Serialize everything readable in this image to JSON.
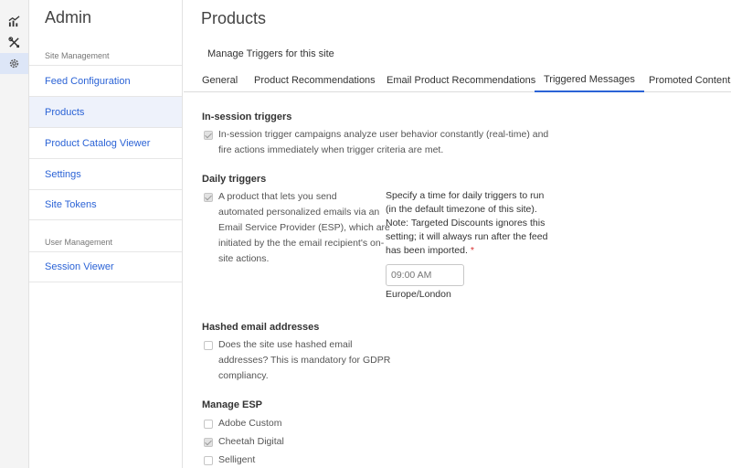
{
  "rail": {
    "icons": [
      "chart-icon",
      "tools-icon",
      "gear-icon"
    ]
  },
  "sidebar": {
    "title": "Admin",
    "section_site": "Site Management",
    "items": [
      {
        "label": "Feed Configuration"
      },
      {
        "label": "Products"
      },
      {
        "label": "Product Catalog Viewer"
      },
      {
        "label": "Settings"
      },
      {
        "label": "Site Tokens"
      }
    ],
    "section_user": "User Management",
    "user_items": [
      {
        "label": "Session Viewer"
      }
    ]
  },
  "main": {
    "title": "Products",
    "manage_title": "Manage Triggers for this site",
    "tabs": [
      {
        "label": "General"
      },
      {
        "label": "Product Recommendations"
      },
      {
        "label": "Email Product Recommendations"
      },
      {
        "label": "Triggered Messages"
      },
      {
        "label": "Promoted Content"
      }
    ],
    "active_tab": "Triggered Messages",
    "in_session": {
      "heading": "In-session triggers",
      "checked": true,
      "line1": "In-session trigger campaigns analyze user behavior constantly (real-time) and",
      "line2": "fire actions immediately when trigger criteria are met."
    },
    "daily": {
      "heading": "Daily triggers",
      "checked": true,
      "line1": "A product that lets you send",
      "line2": "automated personalized emails via an",
      "line3": "Email Service Provider (ESP), which are",
      "line4": "initiated by the the email recipient's on-",
      "line5": "site actions.",
      "time_text1": "Specify a time for daily triggers to run",
      "time_text2": "(in the default timezone of this site).",
      "time_text3": "Note: Targeted Discounts ignores this",
      "time_text4": "setting; it will always run after the feed",
      "time_text5": "has been imported.",
      "required_mark": "*",
      "time_placeholder": "09:00 AM",
      "timezone": "Europe/London"
    },
    "hashed": {
      "heading": "Hashed email addresses",
      "checked": false,
      "line1": "Does the site use hashed email",
      "line2": "addresses? This is mandatory for GDPR",
      "line3": "compliancy."
    },
    "esp": {
      "heading": "Manage ESP",
      "options": [
        {
          "label": "Adobe Custom",
          "checked": false
        },
        {
          "label": "Cheetah Digital",
          "checked": true
        },
        {
          "label": "Selligent",
          "checked": false
        }
      ]
    }
  },
  "colors": {
    "accent": "#2b63d6",
    "active_bg": "#eef2fb",
    "required": "#d83030"
  }
}
